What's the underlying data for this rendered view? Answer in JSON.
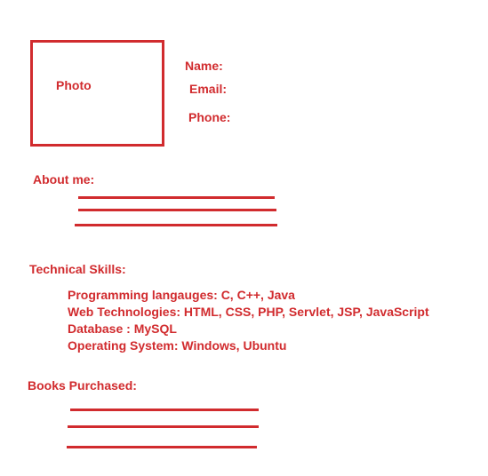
{
  "profile": {
    "photo_label": "Photo",
    "name_label": "Name:",
    "email_label": "Email:",
    "phone_label": "Phone:"
  },
  "about": {
    "heading": "About me:"
  },
  "technical_skills": {
    "heading": "Technical Skills:",
    "items": [
      "Programming langauges: C, C++, Java",
      "Web Technologies: HTML, CSS, PHP, Servlet, JSP, JavaScript",
      "Database : MySQL",
      "Operating System: Windows, Ubuntu"
    ]
  },
  "books": {
    "heading": "Books Purchased:"
  },
  "colors": {
    "accent": "#d12b2e",
    "background": "#ffffff"
  }
}
